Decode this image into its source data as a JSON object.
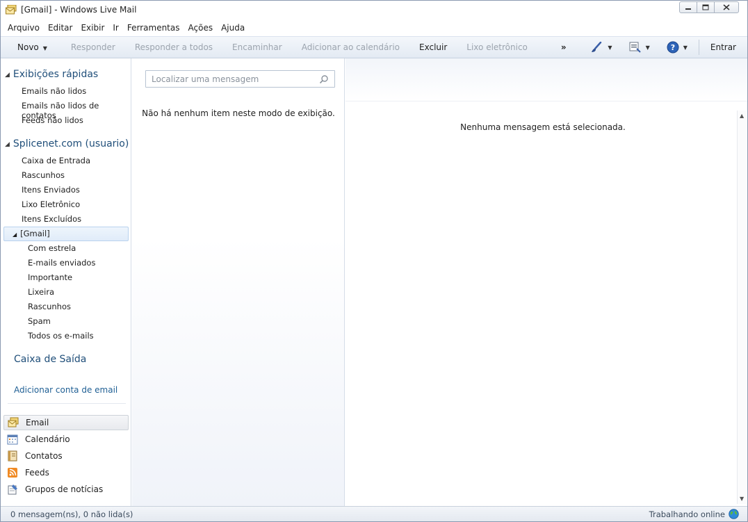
{
  "window": {
    "title": "[Gmail] - Windows Live Mail"
  },
  "menu": [
    "Arquivo",
    "Editar",
    "Exibir",
    "Ir",
    "Ferramentas",
    "Ações",
    "Ajuda"
  ],
  "toolbar": {
    "novo": "Novo",
    "responder": "Responder",
    "responder_todos": "Responder a todos",
    "encaminhar": "Encaminhar",
    "adicionar_calendario": "Adicionar ao calendário",
    "excluir": "Excluir",
    "lixo_eletronico": "Lixo eletrônico",
    "more": "»",
    "entrar": "Entrar"
  },
  "sidebar": {
    "quick_views": {
      "header": "Exibições rápidas",
      "items": [
        "Emails não lidos",
        "Emails não lidos de contatos",
        "Feeds não lidos"
      ]
    },
    "account": {
      "header": "Splicenet.com (usuario)",
      "items": [
        "Caixa de Entrada",
        "Rascunhos",
        "Itens Enviados",
        "Lixo Eletrônico",
        "Itens Excluídos"
      ],
      "gmail": "[Gmail]",
      "gmail_items": [
        "Com estrela",
        "E-mails enviados",
        "Importante",
        "Lixeira",
        "Rascunhos",
        "Spam",
        "Todos os e-mails"
      ]
    },
    "outbox": "Caixa de Saída",
    "add_account": "Adicionar conta de email",
    "nav": [
      "Email",
      "Calendário",
      "Contatos",
      "Feeds",
      "Grupos de notícias"
    ]
  },
  "message_list": {
    "search_placeholder": "Localizar uma mensagem",
    "empty": "Não há nenhum item neste modo de exibição."
  },
  "reading_pane": {
    "empty": "Nenhuma mensagem está selecionada."
  },
  "status": {
    "left": "0 mensagem(ns), 0 não lida(s)",
    "right": "Trabalhando online"
  }
}
